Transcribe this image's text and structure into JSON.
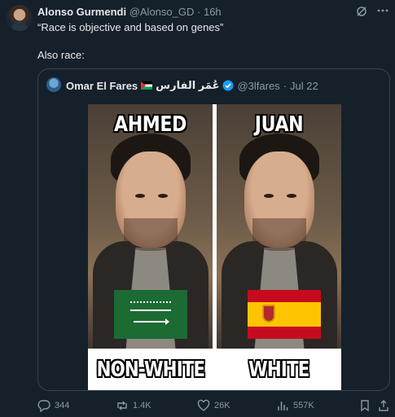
{
  "post": {
    "author_name": "Alonso Gurmendi",
    "author_handle": "@Alonso_GD",
    "separator": "·",
    "time": "16h",
    "line1": "“Race is objective and based on genes”",
    "line2": "Also race:"
  },
  "quote": {
    "author_name": "Omar El Fares",
    "arabic_name": "عُمَر الفارس",
    "author_handle": "@3lfares",
    "separator": "·",
    "date": "Jul 22",
    "meme": {
      "left_top": "AHMED",
      "right_top": "JUAN",
      "left_bottom": "NON-WHITE",
      "right_bottom": "WHITE"
    }
  },
  "actions": {
    "replies": "344",
    "reposts": "1.4K",
    "likes": "26K",
    "views": "557K"
  },
  "colors": {
    "background": "#15202b",
    "text": "#e7e9ea",
    "muted": "#8b98a5",
    "verified": "#1d9bf0"
  },
  "icons": [
    "grok-icon",
    "more-icon",
    "verified-icon",
    "reply-icon",
    "repost-icon",
    "like-icon",
    "views-icon",
    "bookmark-icon",
    "share-icon"
  ]
}
